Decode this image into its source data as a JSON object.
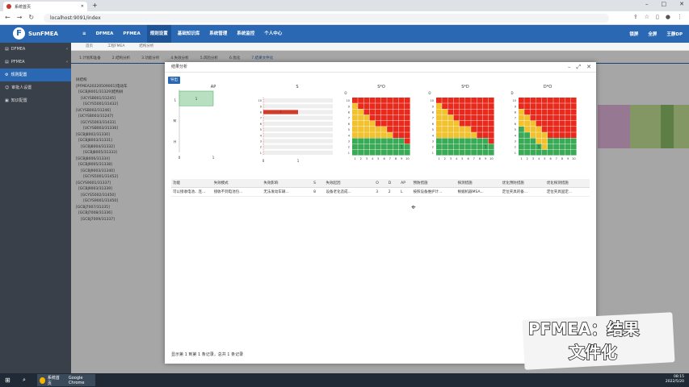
{
  "browser": {
    "tab_title": "系统首页",
    "url": "localhost:9091/index",
    "new_tab": "+"
  },
  "app": {
    "logo_text": "SunFMEA",
    "menu": [
      "DFMEA",
      "PFMEA",
      "规则设置",
      "基础知识库",
      "系统管理",
      "系统监控",
      "个人中心"
    ],
    "header_right": [
      "锁屏",
      "全屏",
      "王静DP"
    ]
  },
  "sidebar": {
    "items": [
      {
        "label": "DFMEA"
      },
      {
        "label": "PFMEA"
      },
      {
        "label": "规则配置"
      },
      {
        "label": "审批人设置"
      },
      {
        "label": "知识配置"
      }
    ]
  },
  "background": {
    "page_tabs": [
      "首页",
      "工程FMEA",
      "结构分析",
      "功能分析",
      "",
      "",
      "",
      ""
    ],
    "step_tabs": [
      "1.计划和准备",
      "2.结构分析",
      "3.功能分析",
      "4.失效分析",
      "5.风险分析",
      "6.优化",
      "7.结果文件化"
    ],
    "tree_header": "树结构",
    "tree_rows": [
      "[PFMEA20220509001]电动车",
      "[GCBJ9001/31329]结构树",
      "[UCYSB001/31245]",
      "[GCYS5001/31432]",
      "[UCYSB002/31246]",
      "[UCYSB003/31247]",
      "[GCYS5003/31433]",
      "[UCYSB003/31336]",
      "[GCBJ8002/31330]",
      "[GCBJ8003/31331]",
      "[GCBJ8004/31332]",
      "[GCBJ8005/31333]",
      "[GCBJ8006/31334]",
      "[GCBJ9005/31338]",
      "[GCBJ9003/31340]",
      "[GCYS5001/31452]",
      "[GCYS9001/31337]",
      "[GCBJ9003/31339]",
      "[GCYS5002/31450]",
      "[GCYS9001/31450]",
      "[GCBJ7007/31335]",
      "[GCBJ7008/31336]",
      "[GCBJ7009/31337]"
    ]
  },
  "modal": {
    "title": "结果分析",
    "export_label": "导出",
    "pager": "显示第 1 到第 1 条记录，总共 1 条记录",
    "table_headers": [
      "功能",
      "失效模式",
      "失效影响",
      "S",
      "失效起因",
      "O",
      "D",
      "AP",
      "预防措施",
      "探测措施",
      "优化预防措施",
      "优化探测措施"
    ],
    "table_rows": [
      [
        "可以接收电池、连...",
        "接收不到电池包...",
        "无法发动车辆...",
        "8",
        "设备老化造成...",
        "3",
        "2",
        "L",
        "按照设备维护计...",
        "根据机器MSA...",
        "定位夹具的备...",
        "定位夹具固定..."
      ]
    ]
  },
  "chart_data": [
    {
      "type": "bar",
      "title": "AP",
      "categories": [
        "L",
        "M",
        "H"
      ],
      "values": [
        1,
        0,
        0
      ],
      "xlim": [
        0,
        1
      ]
    },
    {
      "type": "bar",
      "title": "S",
      "categories": [
        "10",
        "9",
        "8",
        "7",
        "6",
        "5",
        "4",
        "3",
        "2",
        "1"
      ],
      "values": [
        0,
        0,
        1,
        0,
        0,
        0,
        0,
        0,
        0,
        0
      ],
      "xlim": [
        0,
        1
      ]
    },
    {
      "type": "heatmap",
      "title": "S*O",
      "cell_value": {
        "row": 2,
        "col": 8,
        "value": 1
      }
    },
    {
      "type": "heatmap",
      "title": "S*D",
      "cell_value": {
        "row": 2,
        "col": 8,
        "value": 1
      }
    },
    {
      "type": "heatmap",
      "title": "D*O",
      "cell_value": {
        "row": 2,
        "col": 3,
        "value": 1
      }
    }
  ],
  "colors": {
    "red": "#e8291c",
    "yellow": "#f2c12e",
    "green": "#3aaa56",
    "brand": "#2a68b3"
  },
  "caption": {
    "line1": "PFMEA：结果",
    "line2": "文件化"
  },
  "taskbar": {
    "app1": "系统首页",
    "app2": "Google Chrome",
    "time": "08:15",
    "date": "2022/5/20"
  }
}
